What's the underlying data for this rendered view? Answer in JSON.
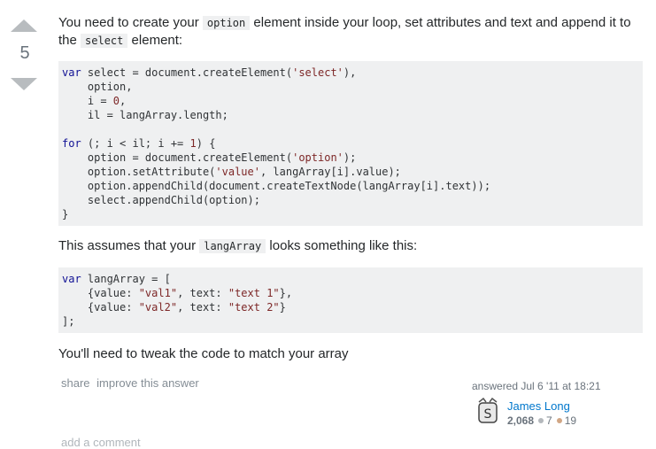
{
  "vote": {
    "score": "5"
  },
  "intro": {
    "part1": "You need to create your ",
    "code1": "option",
    "part2": " element inside your loop, set attributes and text and append it to the ",
    "code2": "select",
    "part3": " element:"
  },
  "code_block_1": [
    "var select = document.createElement('select'),",
    "    option,",
    "    i = 0,",
    "    il = langArray.length;",
    "",
    "for (; i < il; i += 1) {",
    "    option = document.createElement('option');",
    "    option.setAttribute('value', langArray[i].value);",
    "    option.appendChild(document.createTextNode(langArray[i].text));",
    "    select.appendChild(option);",
    "}"
  ],
  "assume": {
    "part1": "This assumes that your ",
    "code": "langArray",
    "part2": " looks something like this:"
  },
  "code_block_2": [
    "var langArray = [",
    "    {value: \"val1\", text: \"text 1\"},",
    "    {value: \"val2\", text: \"text 2\"}",
    "];"
  ],
  "tweak": "You'll need to tweak the code to match your array",
  "post_menu": {
    "share": "share",
    "improve": "improve this answer"
  },
  "signature": {
    "answered": "answered Jul 6 '11 at 18:21",
    "user_name": "James Long",
    "reputation": "2,068",
    "silver": "7",
    "bronze": "19",
    "silver_color": "#b4b8bc",
    "bronze_color": "#d1a684"
  },
  "add_comment": "add a comment"
}
